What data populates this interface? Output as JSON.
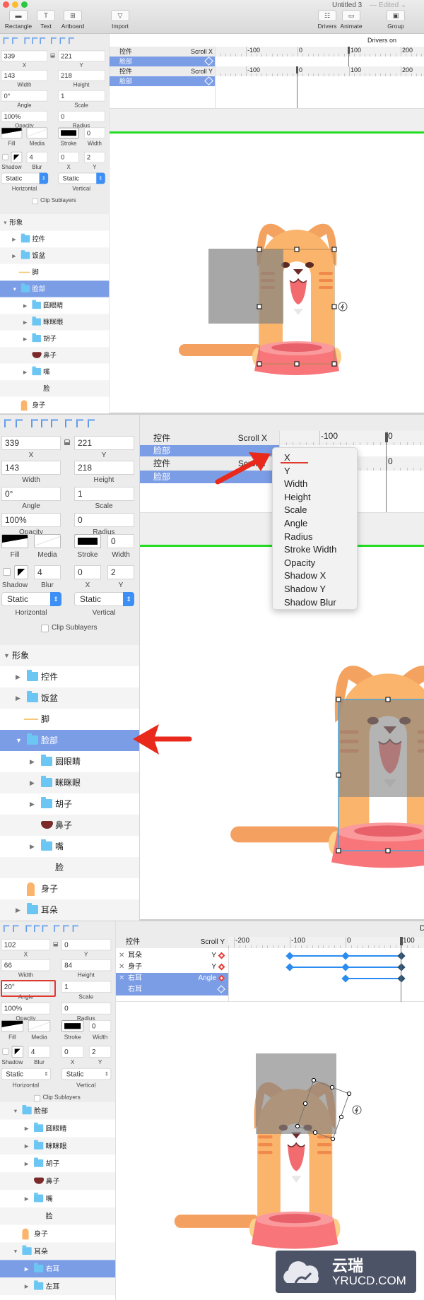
{
  "window": {
    "title": "Untitled 3",
    "status": "— Edited ⌄"
  },
  "toolbar": {
    "buttons": [
      {
        "label": "Rectangle",
        "icon": "rectangle-icon"
      },
      {
        "label": "Text",
        "icon": "text-icon"
      },
      {
        "label": "Artboard",
        "icon": "artboard-icon"
      },
      {
        "label": "Import",
        "icon": "import-icon"
      },
      {
        "label": "Drivers",
        "icon": "drivers-icon"
      },
      {
        "label": "Animate",
        "icon": "animate-icon"
      },
      {
        "label": "Group",
        "icon": "group-icon"
      }
    ]
  },
  "labels": {
    "x": "X",
    "y": "Y",
    "width": "Width",
    "height": "Height",
    "angle": "Angle",
    "scale": "Scale",
    "opacity": "Opacity",
    "radius": "Radius",
    "fill": "Fill",
    "media": "Media",
    "stroke": "Stroke",
    "stroke_width": "Width",
    "shadow": "Shadow",
    "blur": "Blur",
    "shadow_x": "X",
    "shadow_y": "Y",
    "horizontal": "Horizontal",
    "vertical": "Vertical",
    "clip_sublayers": "Clip Sublayers"
  },
  "colors": {
    "selection": "#7b9de6",
    "accent": "#3d8ff5",
    "driver_line": "#22dd22",
    "annotation": "#e8291c"
  },
  "panels": [
    {
      "drivers_label": "Drivers on",
      "properties": {
        "x": "339",
        "y": "221",
        "width": "143",
        "height": "218",
        "angle": "0°",
        "scale": "1",
        "opacity": "100%",
        "radius": "0",
        "stroke_width": "0",
        "blur": "4",
        "shadow_x": "0",
        "shadow_y": "2",
        "horizontal": "Static",
        "vertical": "Static"
      },
      "layers": [
        {
          "label": "形象",
          "level": 0,
          "toggle": "open",
          "icon": "none"
        },
        {
          "label": "控件",
          "level": 1,
          "toggle": "closed",
          "icon": "folder"
        },
        {
          "label": "饭盆",
          "level": 1,
          "toggle": "closed",
          "icon": "folder"
        },
        {
          "label": "脚",
          "level": 1,
          "toggle": "none",
          "icon": "line"
        },
        {
          "label": "脸部",
          "level": 1,
          "toggle": "open",
          "icon": "folder",
          "selected": true
        },
        {
          "label": "圆眼睛",
          "level": 2,
          "toggle": "closed",
          "icon": "folder"
        },
        {
          "label": "眯眯眼",
          "level": 2,
          "toggle": "closed",
          "icon": "folder"
        },
        {
          "label": "胡子",
          "level": 2,
          "toggle": "closed",
          "icon": "folder"
        },
        {
          "label": "鼻子",
          "level": 2,
          "toggle": "none",
          "icon": "nose"
        },
        {
          "label": "嘴",
          "level": 2,
          "toggle": "closed",
          "icon": "folder"
        },
        {
          "label": "脸",
          "level": 2,
          "toggle": "none",
          "icon": "none"
        },
        {
          "label": "身子",
          "level": 1,
          "toggle": "none",
          "icon": "body"
        },
        {
          "label": "耳朵",
          "level": 1,
          "toggle": "closed",
          "icon": "folder"
        }
      ],
      "timeline": {
        "rows": [
          {
            "name": "控件",
            "property": "Scroll X",
            "kind": "header"
          },
          {
            "name": "脸部",
            "kind": "selected"
          },
          {
            "name": "控件",
            "property": "Scroll Y",
            "kind": "header"
          },
          {
            "name": "脸部",
            "kind": "selected"
          }
        ],
        "ruler": [
          "-100",
          "0",
          "100",
          "200"
        ]
      }
    },
    {
      "properties": {
        "x": "339",
        "y": "221",
        "width": "143",
        "height": "218",
        "angle": "0°",
        "scale": "1",
        "opacity": "100%",
        "radius": "0",
        "stroke_width": "0",
        "blur": "4",
        "shadow_x": "0",
        "shadow_y": "2",
        "horizontal": "Static",
        "vertical": "Static"
      },
      "layers": [
        {
          "label": "形象",
          "level": 0,
          "toggle": "open",
          "icon": "none"
        },
        {
          "label": "控件",
          "level": 1,
          "toggle": "closed",
          "icon": "folder"
        },
        {
          "label": "饭盆",
          "level": 1,
          "toggle": "closed",
          "icon": "folder"
        },
        {
          "label": "脚",
          "level": 1,
          "toggle": "none",
          "icon": "line"
        },
        {
          "label": "脸部",
          "level": 1,
          "toggle": "open",
          "icon": "folder",
          "selected": true
        },
        {
          "label": "圆眼睛",
          "level": 2,
          "toggle": "closed",
          "icon": "folder"
        },
        {
          "label": "眯眯眼",
          "level": 2,
          "toggle": "closed",
          "icon": "folder"
        },
        {
          "label": "胡子",
          "level": 2,
          "toggle": "closed",
          "icon": "folder"
        },
        {
          "label": "鼻子",
          "level": 2,
          "toggle": "none",
          "icon": "nose"
        },
        {
          "label": "嘴",
          "level": 2,
          "toggle": "closed",
          "icon": "folder"
        },
        {
          "label": "脸",
          "level": 2,
          "toggle": "none",
          "icon": "none"
        },
        {
          "label": "身子",
          "level": 1,
          "toggle": "none",
          "icon": "body"
        },
        {
          "label": "耳朵",
          "level": 1,
          "toggle": "closed",
          "icon": "folder"
        }
      ],
      "timeline": {
        "rows": [
          {
            "name": "控件",
            "property": "Scroll X",
            "kind": "header"
          },
          {
            "name": "脸部",
            "kind": "selected"
          },
          {
            "name": "控件",
            "property": "Scroll Y",
            "kind": "header"
          },
          {
            "name": "脸部",
            "kind": "selected"
          }
        ],
        "ruler": [
          "-100",
          "0"
        ]
      },
      "property_menu": [
        "X",
        "Y",
        "Width",
        "Height",
        "Scale",
        "Angle",
        "Radius",
        "Stroke Width",
        "Opacity",
        "Shadow X",
        "Shadow Y",
        "Shadow Blur"
      ]
    },
    {
      "drivers_label": "D",
      "properties": {
        "x": "102",
        "y": "0",
        "width": "66",
        "height": "84",
        "angle": "20°",
        "scale": "1",
        "opacity": "100%",
        "radius": "0",
        "stroke_width": "0",
        "blur": "4",
        "shadow_x": "0",
        "shadow_y": "2",
        "horizontal": "Static",
        "vertical": "Static"
      },
      "layers": [
        {
          "label": "脸部",
          "level": 1,
          "toggle": "open",
          "icon": "folder"
        },
        {
          "label": "圆眼睛",
          "level": 2,
          "toggle": "closed",
          "icon": "folder"
        },
        {
          "label": "眯眯眼",
          "level": 2,
          "toggle": "closed",
          "icon": "folder"
        },
        {
          "label": "胡子",
          "level": 2,
          "toggle": "closed",
          "icon": "folder"
        },
        {
          "label": "鼻子",
          "level": 2,
          "toggle": "none",
          "icon": "nose"
        },
        {
          "label": "嘴",
          "level": 2,
          "toggle": "closed",
          "icon": "folder"
        },
        {
          "label": "脸",
          "level": 2,
          "toggle": "none",
          "icon": "none"
        },
        {
          "label": "身子",
          "level": 1,
          "toggle": "none",
          "icon": "body"
        },
        {
          "label": "耳朵",
          "level": 1,
          "toggle": "open",
          "icon": "folder"
        },
        {
          "label": "右耳",
          "level": 2,
          "toggle": "closed",
          "icon": "folder",
          "selected": true
        },
        {
          "label": "左耳",
          "level": 2,
          "toggle": "closed",
          "icon": "folder"
        }
      ],
      "timeline": {
        "header": {
          "name": "控件",
          "property": "Scroll Y"
        },
        "rows": [
          {
            "name": "耳朵",
            "property": "Y",
            "keyframes": [
              -100,
              0,
              100
            ]
          },
          {
            "name": "身子",
            "property": "Y",
            "keyframes": [
              -100,
              0,
              100
            ]
          },
          {
            "name": "右耳",
            "property": "Angle",
            "keyframes": [
              0,
              100
            ],
            "selected": true
          },
          {
            "name": "右耳",
            "selected": true,
            "child": true
          }
        ],
        "ruler": [
          "-200",
          "-100",
          "0",
          "100"
        ],
        "playhead": 100
      }
    }
  ],
  "watermark": {
    "brand": "云瑞",
    "domain": "YRUCD.COM"
  }
}
